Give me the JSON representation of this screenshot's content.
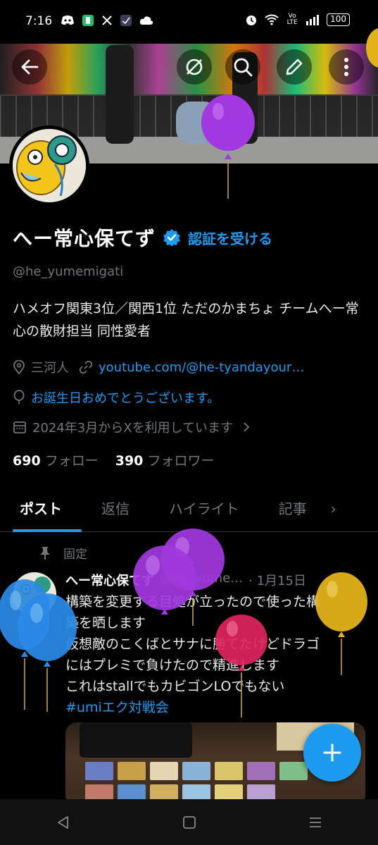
{
  "status_bar": {
    "time": "7:16",
    "battery": "100",
    "network": "Vo LTE"
  },
  "profile": {
    "display_name": "へー常心保てず",
    "verify_link": "認証を受ける",
    "handle": "@he_yumemigati",
    "bio": "ハメオフ関東3位／関西1位 ただのかまちょ チームへー常心の散財担当 同性愛者",
    "location": "三河人",
    "website": "youtube.com/@he-tyandayour…",
    "birthday": "お誕生日おめでとうございます。",
    "joined": "2024年3月からXを利用しています",
    "following_count": "690",
    "following_label": "フォロー",
    "followers_count": "390",
    "followers_label": "フォロワー"
  },
  "tabs": [
    {
      "label": "ポスト",
      "active": true
    },
    {
      "label": "返信",
      "active": false
    },
    {
      "label": "ハイライト",
      "active": false
    },
    {
      "label": "記事",
      "active": false
    }
  ],
  "tabs_more": "›",
  "post": {
    "pinned_label": "固定",
    "author": "へー常心保てず",
    "handle": "@he_yume…",
    "date": "· 1月15日",
    "lines": [
      "構築を変更する目処が立ったので使った構",
      "築を晒します",
      "仮想敵のこくばとサナに勝てたけどドラゴ",
      "にはプレミで負けたので精進します",
      "これはstallでもカビゴンLOでもない"
    ],
    "hashtag": "#umiエク対戦会"
  },
  "colors": {
    "accent": "#1d9bf0",
    "background": "#000000",
    "muted": "#71767b"
  },
  "icons": {
    "back": "arrow-left",
    "grok": "circle-slash",
    "search": "magnifier",
    "edit": "pencil",
    "more": "vertical-dots",
    "verified": "verified-badge",
    "location": "location-pin",
    "link": "link",
    "birthday": "balloon",
    "calendar": "calendar",
    "pin": "pushpin",
    "fab": "plus"
  }
}
